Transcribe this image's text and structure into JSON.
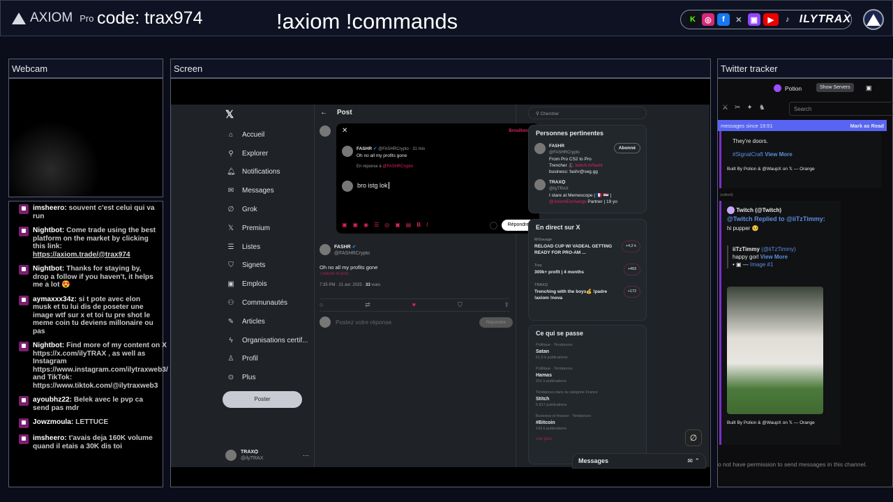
{
  "topbar": {
    "logo": "AXIOM",
    "logo_sub": "Pro",
    "code": "code: trax974",
    "commands": "!axiom !commands",
    "brand": "ILYTRAX"
  },
  "panels": {
    "webcam": "Webcam",
    "screen": "Screen",
    "tracker": "Twitter tracker"
  },
  "chat": [
    {
      "user": "imsheero:",
      "text": "souvent c'est celui qui va run"
    },
    {
      "user": "Nightbot:",
      "text": "Come trade using the best platform on the market by clicking this link: ",
      "link": "https://axiom.trade/@trax974"
    },
    {
      "user": "Nightbot:",
      "text": "Thanks for staying by, drop a follow if you haven't, it helps me a lot 😍"
    },
    {
      "user": "aymaxxx34z:",
      "text": "si t pote avec elon musk et tu lui dis de poseter une image wtf sur x et toi tu pre shot le meme coin tu deviens millonaire ou pas"
    },
    {
      "user": "Nightbot:",
      "text": "Find more of my content on X https://x.com/ilyTRAX , as well as Instagram https://www.instagram.com/ilytraxweb3/ and TikTok: https://www.tiktok.com/@ilytraxweb3"
    },
    {
      "user": "ayoubhz22:",
      "text": "Belek avec le pvp ca send pas mdr"
    },
    {
      "user": "Jowzmoula:",
      "text": "LETTUCE"
    },
    {
      "user": "imsheero:",
      "text": "t'avais deja 160K volume quand il etais a 30K dis toi"
    }
  ],
  "x": {
    "nav": [
      "Accueil",
      "Explorer",
      "Notifications",
      "Messages",
      "Grok",
      "Premium",
      "Listes",
      "Signets",
      "Emplois",
      "Communautés",
      "Articles",
      "Organisations certif...",
      "Profil",
      "Plus"
    ],
    "nav_icons": [
      "⌂",
      "⚲",
      "🔔︎",
      "✉",
      "∅",
      "𝕏",
      "☰",
      "⛉",
      "▣",
      "⚇",
      "✎",
      "ϟ",
      "♙",
      "⊙"
    ],
    "post_button": "Poster",
    "account": {
      "name": "TRAX⌬",
      "handle": "@ilyTRAX"
    },
    "header": "Post",
    "modal": {
      "draft": "Brouillons",
      "author": "FASHR",
      "handle": "@FASHRCrypto · 31 min",
      "text": "Oh no all my profits gone",
      "reply_to": "En réponse à ",
      "reply_handle": "@FASHRCrypto",
      "input": "bro istg lok",
      "reply_button": "Répondre"
    },
    "tweet": {
      "author": "FASHR",
      "handle": "@FASHRCrypto",
      "text": "Oh no all my profits gone",
      "translate": "Traduire le post",
      "meta": "7:35 PM · 21 avr. 2025 · ",
      "views": "33",
      "views_label": " vues"
    },
    "reply_placeholder": "Postez votre réponse",
    "reply_button": "Répondre",
    "search": "Chercher",
    "people": {
      "title": "Personnes pertinentes",
      "items": [
        {
          "name": "FASHR",
          "handle": "@FASHRCrypto",
          "follow": "Abonné",
          "bio": "From Pro CS2 to Pro Trencher 🎩 ",
          "bio_link": "twitch.tv/fashr",
          "bio2": " business: fashr@seg.gg"
        },
        {
          "name": "TRAX⌬",
          "handle": "@ilyTRAX",
          "bio": "I stare at Memescope | 🇫🇷 🇳🇱 | ",
          "bio_link": "@AxiomExchange",
          "bio2": " Partner | 19 yo"
        }
      ]
    },
    "live": {
      "title": "En direct sur X",
      "items": [
        {
          "user": "MrSavage",
          "text": "RELOAD CUP W/ VADEAL GETTING READY FOR PRO-AM ...",
          "count": "+4,2 k"
        },
        {
          "user": "Trey",
          "text": "300k+ profit | 4 months",
          "count": "+493"
        },
        {
          "user": "TRAX⌬",
          "text": "Trenching with the boys💰 !padre !axiom !nova",
          "count": "+172"
        }
      ]
    },
    "trends": {
      "title": "Ce qui se passe",
      "items": [
        {
          "cat": "Politique · Tendances",
          "name": "Satan",
          "count": "61,6 k publications"
        },
        {
          "cat": "Politique · Tendances",
          "name": "Hamas",
          "count": "151 k publications"
        },
        {
          "cat": "Tendances dans la catégorie France",
          "name": "Stitch",
          "count": "5 817 publications"
        },
        {
          "cat": "Business et finance · Tendances",
          "name": "#Bitcoin",
          "count": "143 k publications"
        }
      ],
      "more": "Voir plus"
    },
    "messages": "Messages"
  },
  "tracker": {
    "server": "Potion",
    "show_servers": "Show Servers",
    "search": "Search",
    "banner": "messages since 19:51",
    "mark_read": "Mark as Read",
    "msg1": "They're doors.",
    "tag": "#SignalCraft",
    "view_more": "View More",
    "footer": "Built By Potion & @WaupX on 𝕏  —  Orange",
    "edited": "(edited)",
    "author": "Twitch (@Twitch)",
    "replied": "@Twitch Replied to @iiTzTimmy:",
    "text": "hi pupper 🥺",
    "quote_author": "iiTzTimmy",
    "quote_handle": "(@iiTzTimmy)",
    "quote_text": "happy gorl",
    "image": "Image #1",
    "no_perm": "o not have permission to send messages in this channel."
  },
  "colors": {
    "accent": "#e0245e",
    "banner": "#5865f2",
    "twitch": "#9146ff"
  }
}
